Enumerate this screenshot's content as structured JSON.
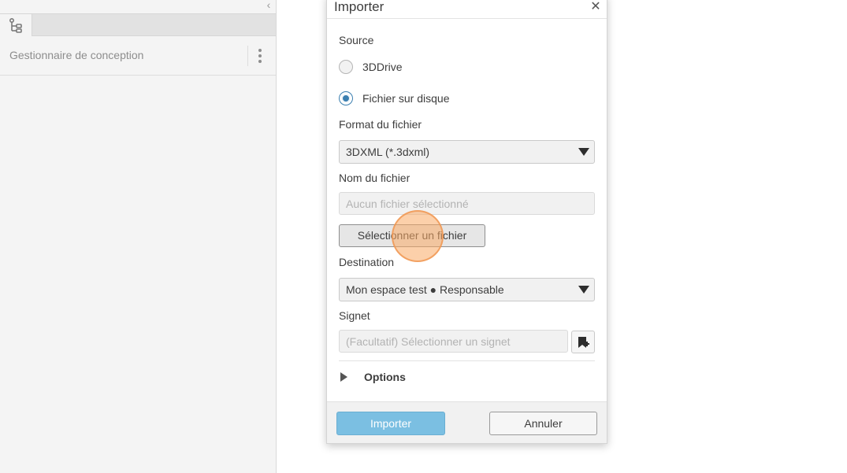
{
  "left_panel": {
    "title": "Gestionnaire de conception",
    "collapse_icon": "chevron-left-icon",
    "tab_icon": "tree-structure-icon",
    "menu_icon": "kebab-menu-icon"
  },
  "dialog": {
    "title": "Importer",
    "close_symbol": "✕",
    "source_label": "Source",
    "sources": [
      {
        "label": "3DDrive",
        "checked": false
      },
      {
        "label": "Fichier sur disque",
        "checked": true
      }
    ],
    "format_label": "Format du fichier",
    "format_value": "3DXML (*.3dxml)",
    "filename_label": "Nom du fichier",
    "filename_placeholder": "Aucun fichier sélectionné",
    "select_file_button": "Sélectionner un fichier",
    "destination_label": "Destination",
    "destination_value": "Mon espace test ● Responsable",
    "bookmark_label": "Signet",
    "bookmark_placeholder": "(Facultatif) Sélectionner un signet",
    "bookmark_icon": "bookmark-add-icon",
    "options_label": "Options",
    "import_button": "Importer",
    "cancel_button": "Annuler"
  },
  "colors": {
    "primary": "#7bbfe2",
    "radio_checked": "#3b7fb0",
    "click_highlight": "#f5a25f"
  }
}
